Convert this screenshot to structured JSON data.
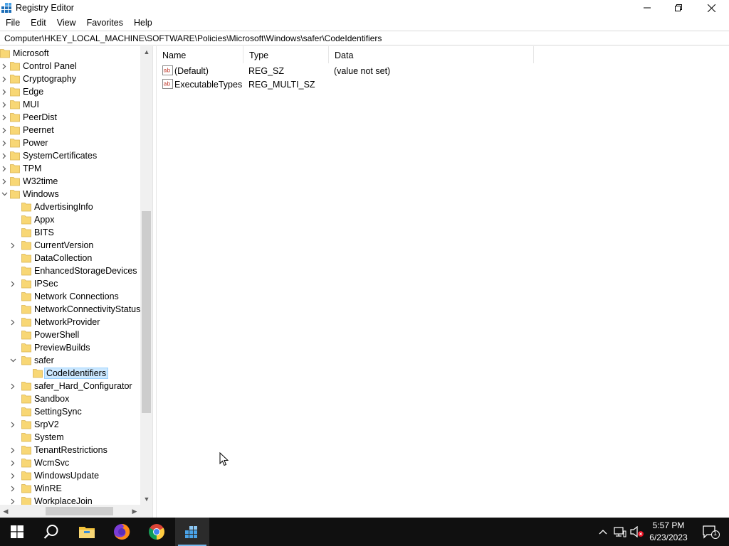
{
  "window": {
    "title": "Registry Editor",
    "controls": [
      "minimize",
      "maximize",
      "close"
    ]
  },
  "menu": [
    "File",
    "Edit",
    "View",
    "Favorites",
    "Help"
  ],
  "address": "Computer\\HKEY_LOCAL_MACHINE\\SOFTWARE\\Policies\\Microsoft\\Windows\\safer\\CodeIdentifiers",
  "tree": [
    {
      "label": "Microsoft",
      "level": 0,
      "expander": "none"
    },
    {
      "label": "Control Panel",
      "level": 1,
      "expander": "collapsed"
    },
    {
      "label": "Cryptography",
      "level": 1,
      "expander": "collapsed"
    },
    {
      "label": "Edge",
      "level": 1,
      "expander": "collapsed"
    },
    {
      "label": "MUI",
      "level": 1,
      "expander": "collapsed"
    },
    {
      "label": "PeerDist",
      "level": 1,
      "expander": "collapsed"
    },
    {
      "label": "Peernet",
      "level": 1,
      "expander": "collapsed"
    },
    {
      "label": "Power",
      "level": 1,
      "expander": "collapsed"
    },
    {
      "label": "SystemCertificates",
      "level": 1,
      "expander": "collapsed"
    },
    {
      "label": "TPM",
      "level": 1,
      "expander": "collapsed"
    },
    {
      "label": "W32time",
      "level": 1,
      "expander": "collapsed"
    },
    {
      "label": "Windows",
      "level": 1,
      "expander": "expanded"
    },
    {
      "label": "AdvertisingInfo",
      "level": 2,
      "expander": "none"
    },
    {
      "label": "Appx",
      "level": 2,
      "expander": "none"
    },
    {
      "label": "BITS",
      "level": 2,
      "expander": "none"
    },
    {
      "label": "CurrentVersion",
      "level": 2,
      "expander": "collapsed"
    },
    {
      "label": "DataCollection",
      "level": 2,
      "expander": "none"
    },
    {
      "label": "EnhancedStorageDevices",
      "level": 2,
      "expander": "none"
    },
    {
      "label": "IPSec",
      "level": 2,
      "expander": "collapsed"
    },
    {
      "label": "Network Connections",
      "level": 2,
      "expander": "none"
    },
    {
      "label": "NetworkConnectivityStatusIr",
      "level": 2,
      "expander": "none"
    },
    {
      "label": "NetworkProvider",
      "level": 2,
      "expander": "collapsed"
    },
    {
      "label": "PowerShell",
      "level": 2,
      "expander": "none"
    },
    {
      "label": "PreviewBuilds",
      "level": 2,
      "expander": "none"
    },
    {
      "label": "safer",
      "level": 2,
      "expander": "expanded"
    },
    {
      "label": "CodeIdentifiers",
      "level": 3,
      "expander": "none",
      "selected": true
    },
    {
      "label": "safer_Hard_Configurator",
      "level": 2,
      "expander": "collapsed"
    },
    {
      "label": "Sandbox",
      "level": 2,
      "expander": "none"
    },
    {
      "label": "SettingSync",
      "level": 2,
      "expander": "none"
    },
    {
      "label": "SrpV2",
      "level": 2,
      "expander": "collapsed"
    },
    {
      "label": "System",
      "level": 2,
      "expander": "none"
    },
    {
      "label": "TenantRestrictions",
      "level": 2,
      "expander": "collapsed"
    },
    {
      "label": "WcmSvc",
      "level": 2,
      "expander": "collapsed"
    },
    {
      "label": "WindowsUpdate",
      "level": 2,
      "expander": "collapsed"
    },
    {
      "label": "WinRE",
      "level": 2,
      "expander": "collapsed"
    },
    {
      "label": "WorkplaceJoin",
      "level": 2,
      "expander": "collapsed"
    }
  ],
  "list": {
    "columns": [
      "Name",
      "Type",
      "Data"
    ],
    "rows": [
      {
        "name": "(Default)",
        "type": "REG_SZ",
        "data": "(value not set)",
        "icon": "string-value-icon"
      },
      {
        "name": "ExecutableTypes",
        "type": "REG_MULTI_SZ",
        "data": "",
        "icon": "string-value-icon"
      }
    ]
  },
  "taskbar": {
    "apps": [
      "start",
      "search",
      "file-explorer",
      "firefox",
      "chrome",
      "registry-editor"
    ],
    "active_app": "registry-editor",
    "clock_time": "5:57 PM",
    "clock_date": "6/23/2023",
    "notification_count": "1"
  },
  "colors": {
    "selection": "#cce8ff",
    "selection_border": "#99d1ff",
    "folder": "#f8d775",
    "taskbar": "#101010",
    "accent": "#76b9ed"
  }
}
